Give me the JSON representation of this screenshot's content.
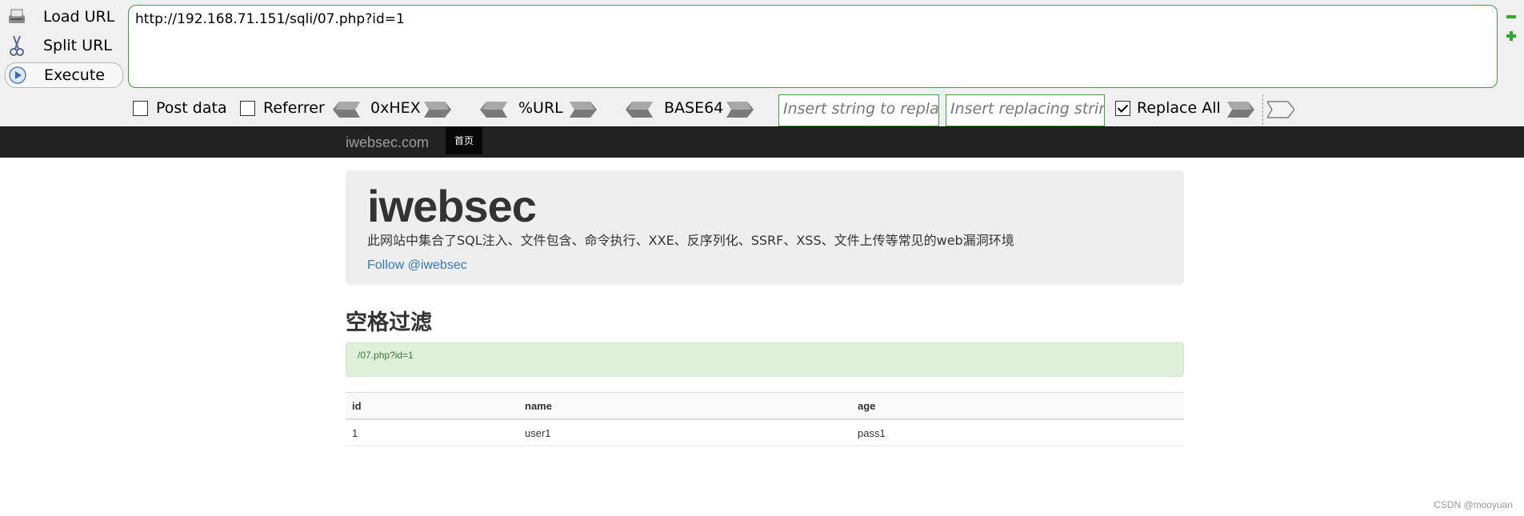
{
  "hackbar": {
    "load_url": "Load URL",
    "split_url": "Split URL",
    "execute": "Execute",
    "url_value": "http://192.168.71.151/sqli/07.php?id=1",
    "post_data": "Post data",
    "referrer": "Referrer",
    "hex": "0xHEX",
    "url_enc": "%URL",
    "base64": "BASE64",
    "insert_placeholder": "Insert string to replace",
    "replacing_placeholder": "Insert replacing string",
    "replace_all": "Replace All",
    "post_data_checked": false,
    "referrer_checked": false,
    "replace_all_checked": true
  },
  "navbar": {
    "brand": "iwebsec.com",
    "home": "首页"
  },
  "jumbotron": {
    "title": "iwebsec",
    "description": "此网站中集合了SQL注入、文件包含、命令执行、XXE、反序列化、SSRF、XSS、文件上传等常见的web漏洞环境",
    "follow": "Follow @iwebsec"
  },
  "section": {
    "title": "空格过滤",
    "alert": "/07.php?id=1"
  },
  "table": {
    "headers": [
      "id",
      "name",
      "age"
    ],
    "rows": [
      [
        "1",
        "user1",
        "pass1"
      ]
    ]
  },
  "watermark": "CSDN @mooyuan",
  "colors": {
    "accent_green": "#3aa33a",
    "navbar_bg": "#222222",
    "link_blue": "#337ab7",
    "alert_green": "#dff0d8"
  }
}
